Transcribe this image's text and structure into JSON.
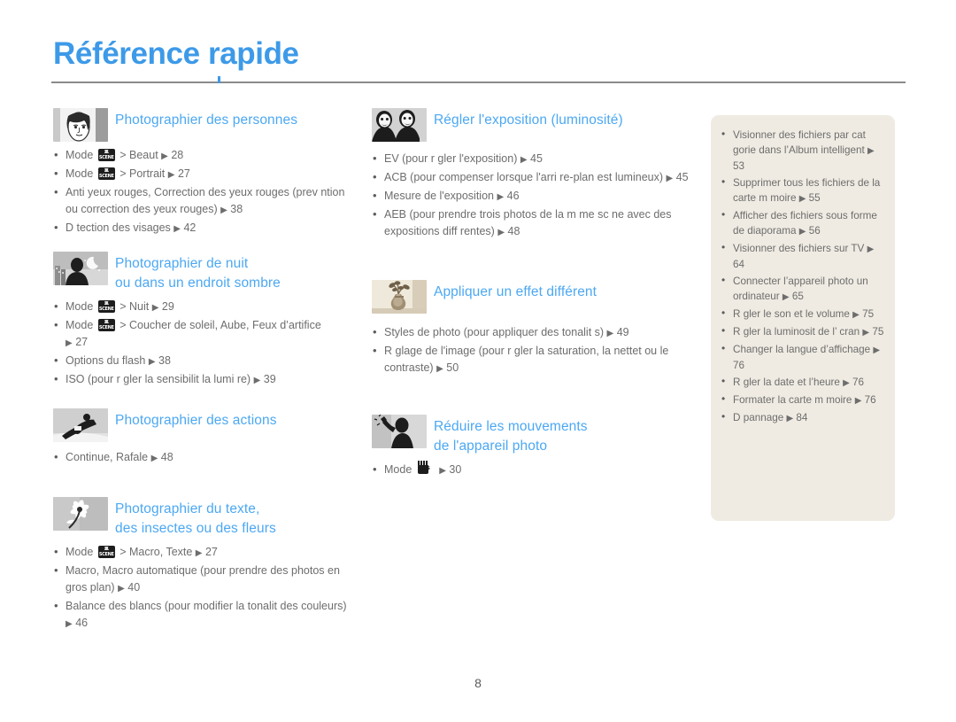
{
  "header": {
    "title": "Référence rapide"
  },
  "footer": {
    "page_number": "8"
  },
  "colors": {
    "accent_blue": "#4ca8f2",
    "title_blue": "#3d9ae8",
    "body_gray": "#6d6d6d",
    "panel_bg": "#efebe2",
    "rule_gray": "#8a8a8a"
  },
  "sections": {
    "people": {
      "icon": "portrait-photo-thumbnail",
      "title_line1": "Photographier des personnes",
      "items": [
        {
          "pre": "Mode ",
          "icon": "scene-mode-icon",
          "post": " > Beaut",
          "arrow": "▶",
          "page": "28"
        },
        {
          "pre": "Mode ",
          "icon": "scene-mode-icon",
          "post": " > Portrait ",
          "arrow": "▶",
          "page": "27"
        },
        {
          "pre": "Anti yeux rouges, Correction des yeux rouges (prev ntion ou correction des yeux rouges) ",
          "arrow": "▶",
          "page": "38"
        },
        {
          "pre": "D tection des visages ",
          "arrow": "▶",
          "page": "42"
        }
      ]
    },
    "night": {
      "icon": "night-scene-thumbnail",
      "title_line1": "Photographier de nuit",
      "title_line2": "ou dans un endroit sombre",
      "items": [
        {
          "pre": "Mode ",
          "icon": "scene-mode-icon",
          "post": " > Nuit ",
          "arrow": "▶",
          "page": "29"
        },
        {
          "pre": "Mode ",
          "icon": "scene-mode-icon",
          "post": " > Coucher de soleil, Aube, Feux d’artifice ",
          "arrow": "▶",
          "page": "27"
        },
        {
          "pre": "Options du flash ",
          "arrow": "▶",
          "page": "38"
        },
        {
          "pre": "ISO (pour r gler la sensibilit    la lumi re) ",
          "arrow": "▶",
          "page": "39"
        }
      ]
    },
    "action": {
      "icon": "snowboarder-thumbnail",
      "title_line1": "Photographier des actions",
      "items": [
        {
          "pre": "Continue, Rafale ",
          "arrow": "▶",
          "page": "48"
        }
      ]
    },
    "text_macro": {
      "icon": "flower-macro-thumbnail",
      "title_line1": "Photographier du texte,",
      "title_line2": "des insectes ou des fleurs",
      "items": [
        {
          "pre": "Mode ",
          "icon": "scene-mode-icon",
          "post": " > Macro, Texte ",
          "arrow": "▶",
          "page": "27"
        },
        {
          "pre": "Macro, Macro automatique (pour prendre des photos en gros plan) ",
          "arrow": "▶",
          "page": "40"
        },
        {
          "pre": "Balance des blancs (pour modifier la tonalit  des couleurs) ",
          "arrow": "▶",
          "page": "46"
        }
      ]
    },
    "exposure": {
      "icon": "two-faces-thumbnail",
      "title_line1": "Régler l'exposition (luminosité)",
      "items": [
        {
          "pre": "EV (pour r gler l'exposition) ",
          "arrow": "▶",
          "page": "45"
        },
        {
          "pre": "ACB (pour compenser lorsque l'arri re-plan est lumineux) ",
          "arrow": "▶",
          "page": "45"
        },
        {
          "pre": "Mesure de l'exposition ",
          "arrow": "▶",
          "page": "46"
        },
        {
          "pre": "AEB (pour prendre trois photos de la m me sc ne avec des expositions diff rentes) ",
          "arrow": "▶",
          "page": "48"
        }
      ]
    },
    "effects": {
      "icon": "vase-flowers-thumbnail",
      "title_line1": "Appliquer un effet différent",
      "items": [
        {
          "pre": "Styles de photo (pour appliquer des tonalit s) ",
          "arrow": "▶",
          "page": "49"
        },
        {
          "pre": "R glage de l'image (pour r gler la saturation, la nettet  ou le contraste) ",
          "arrow": "▶",
          "page": "50"
        }
      ]
    },
    "stabilize": {
      "icon": "shaking-hands-thumbnail",
      "title_line1": "Réduire les mouvements",
      "title_line2": "de l'appareil photo",
      "items": [
        {
          "pre": "Mode ",
          "icon": "dis-mode-icon",
          "post": " ",
          "arrow": "▶",
          "page": "30"
        }
      ]
    }
  },
  "side_panel": {
    "items": [
      {
        "text": "Visionner des fichiers par cat gorie dans l’Album intelligent ",
        "arrow": "▶",
        "page": "53"
      },
      {
        "text": "Supprimer tous les fichiers de la carte m moire ",
        "arrow": "▶",
        "page": "55"
      },
      {
        "text": "Afficher des fichiers sous forme de diaporama ",
        "arrow": "▶",
        "page": "56"
      },
      {
        "text": "Visionner des fichiers sur TV ",
        "arrow": "▶",
        "page": "64"
      },
      {
        "text": "Connecter l’appareil photo  un ordinateur ",
        "arrow": "▶",
        "page": "65"
      },
      {
        "text": "R gler le son et le volume ",
        "arrow": "▶",
        "page": "75"
      },
      {
        "text": "R gler la luminosit  de l’ cran ",
        "arrow": "▶",
        "page": "75"
      },
      {
        "text": "Changer la langue d’affichage ",
        "arrow": "▶",
        "page": "76"
      },
      {
        "text": "R gler la date et l’heure ",
        "arrow": "▶",
        "page": "76"
      },
      {
        "text": "Formater la carte m moire ",
        "arrow": "▶",
        "page": "76"
      },
      {
        "text": "D pannage ",
        "arrow": "▶",
        "page": "84"
      }
    ]
  }
}
